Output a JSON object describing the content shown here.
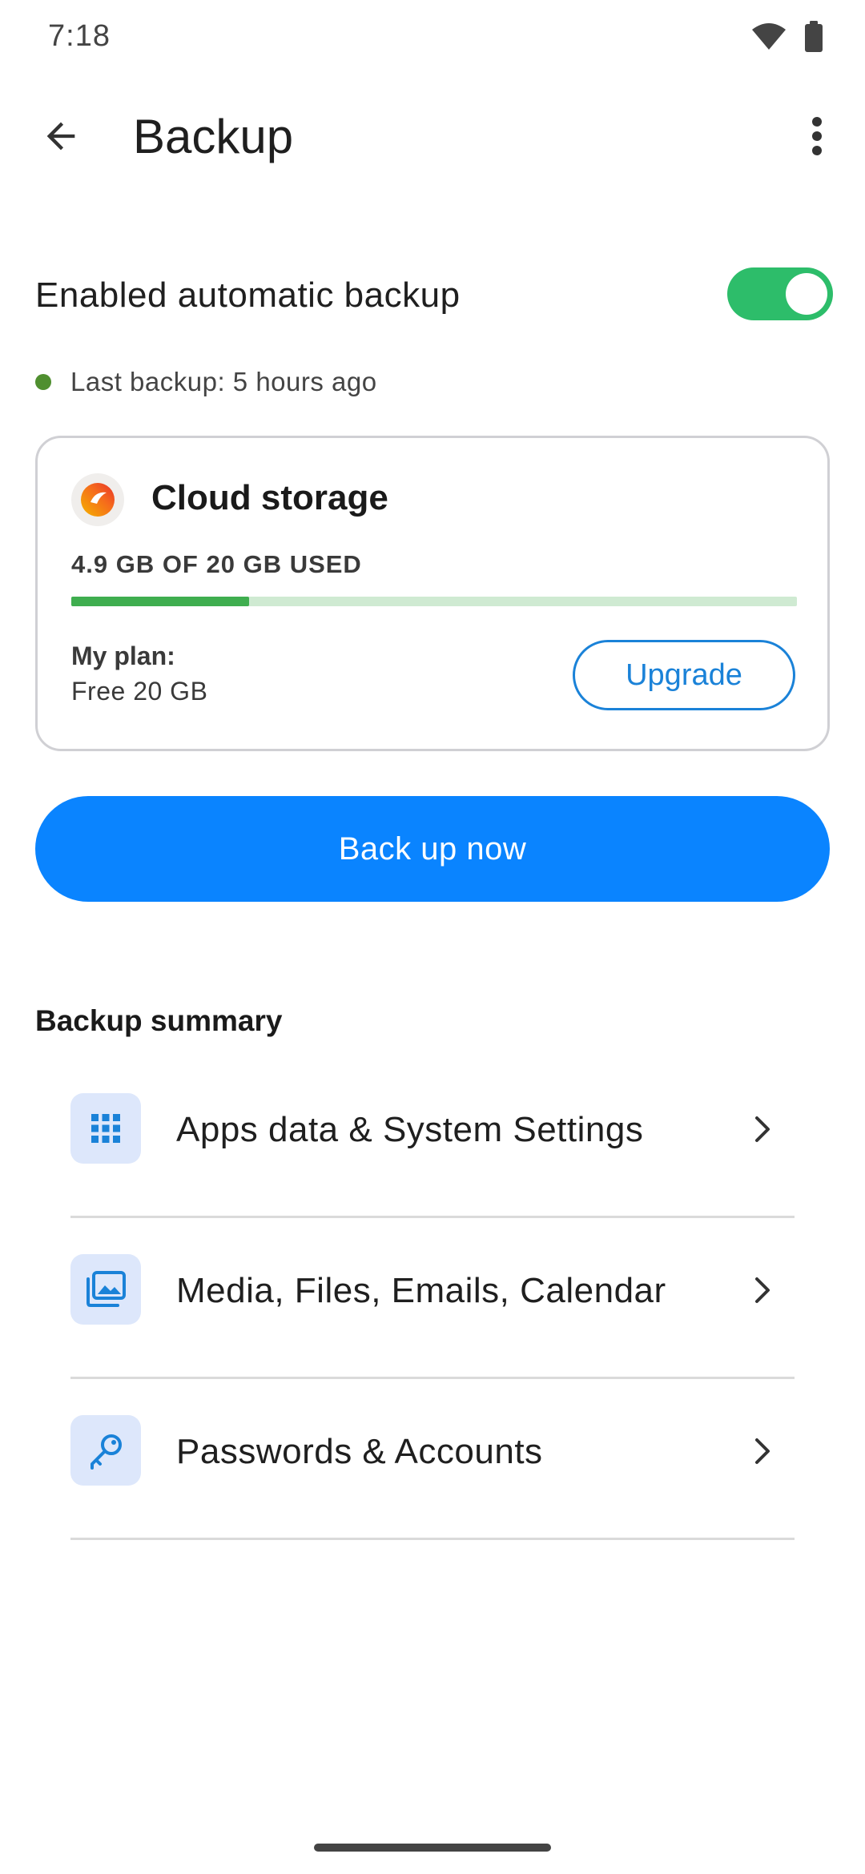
{
  "status_bar": {
    "time": "7:18",
    "icons": [
      "wifi-icon",
      "battery-icon"
    ]
  },
  "app_bar": {
    "title": "Backup",
    "back_icon": "arrow-back-icon",
    "menu_icon": "more-vert-icon"
  },
  "auto_backup": {
    "label": "Enabled automatic backup",
    "enabled": true,
    "last_backup": "Last backup: 5 hours ago"
  },
  "storage": {
    "title": "Cloud storage",
    "usage": "4.9 GB OF 20 GB USED",
    "used_fraction": 0.245,
    "plan_label": "My plan:",
    "plan_value": "Free 20 GB",
    "upgrade_label": "Upgrade"
  },
  "backup_now_label": "Back up now",
  "summary": {
    "title": "Backup summary",
    "items": [
      {
        "label": "Apps data & System Settings",
        "icon": "apps-grid-icon"
      },
      {
        "label": "Media, Files, Emails, Calendar",
        "icon": "photo-library-icon"
      },
      {
        "label": "Passwords & Accounts",
        "icon": "key-icon"
      }
    ]
  },
  "colors": {
    "accent": "#0a84ff",
    "toggle_on": "#2dbd6a",
    "progress_fill": "#3fae4f",
    "progress_track": "#cfead2",
    "icon_bg": "#dde7fb",
    "icon_fg": "#1a82d8"
  }
}
